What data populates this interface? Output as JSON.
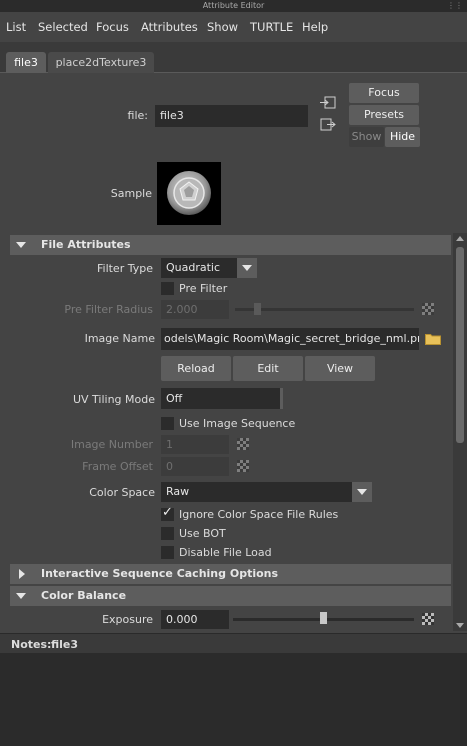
{
  "window": {
    "title": "Attribute Editor"
  },
  "menu": [
    "List",
    "Selected",
    "Focus",
    "Attributes",
    "Show",
    "TURTLE",
    "Help"
  ],
  "tabs": [
    {
      "label": "file3",
      "active": true
    },
    {
      "label": "place2dTexture3",
      "active": false
    }
  ],
  "header": {
    "file_label": "file:",
    "file_value": "file3",
    "focus_button": "Focus",
    "presets_button": "Presets",
    "show_button": "Show",
    "hide_button": "Hide",
    "sample_label": "Sample"
  },
  "file_attributes": {
    "section_title": "File Attributes",
    "filter_type_label": "Filter Type",
    "filter_type_value": "Quadratic",
    "pre_filter_label": "Pre Filter",
    "pre_filter_checked": false,
    "pre_filter_radius_label": "Pre Filter Radius",
    "pre_filter_radius_value": "2.000",
    "image_name_label": "Image Name",
    "image_name_value": "odels\\Magic Room\\Magic_secret_bridge_nml.png",
    "reload_button": "Reload",
    "edit_button": "Edit",
    "view_button": "View",
    "uv_tiling_label": "UV Tiling Mode",
    "uv_tiling_value": "Off",
    "use_image_sequence_label": "Use Image Sequence",
    "use_image_sequence_checked": false,
    "image_number_label": "Image Number",
    "image_number_value": "1",
    "frame_offset_label": "Frame Offset",
    "frame_offset_value": "0",
    "color_space_label": "Color Space",
    "color_space_value": "Raw",
    "ignore_cs_label": "Ignore Color Space File Rules",
    "ignore_cs_checked": true,
    "use_bot_label": "Use BOT",
    "use_bot_checked": false,
    "disable_load_label": "Disable File Load",
    "disable_load_checked": false
  },
  "interactive_sequence": {
    "section_title": "Interactive Sequence Caching Options"
  },
  "color_balance": {
    "section_title": "Color Balance",
    "exposure_label": "Exposure",
    "exposure_value": "0.000"
  },
  "notes": {
    "label": "Notes:",
    "node": "file3"
  },
  "colors": {
    "background": "#444444",
    "field": "#2b2b2b",
    "button": "#5d5d5d",
    "section_header": "#5d5d5d",
    "folder_icon": "#e8c15a"
  }
}
